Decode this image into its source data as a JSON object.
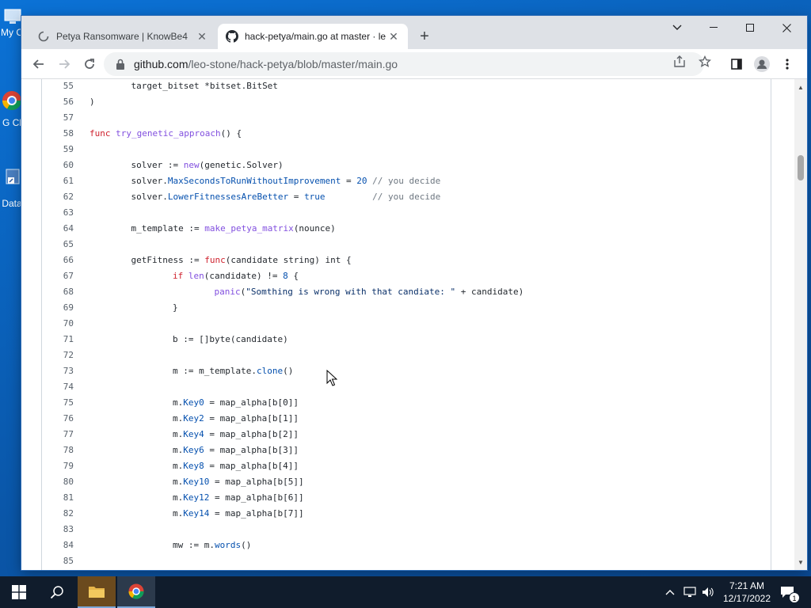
{
  "desktop": {
    "icons": [
      {
        "label": "My C"
      },
      {
        "label": "G Cl"
      },
      {
        "label": "Data"
      }
    ]
  },
  "browser": {
    "tabs": [
      {
        "title": "Petya Ransomware | KnowBe4",
        "active": false,
        "icon": "knowbe4-spinner-icon"
      },
      {
        "title": "hack-petya/main.go at master · le",
        "active": true,
        "icon": "github-icon"
      }
    ],
    "url_host": "github.com",
    "url_path": "/leo-stone/hack-petya/blob/master/main.go"
  },
  "code": {
    "lines": [
      {
        "n": "55",
        "indent": 1,
        "parts": [
          {
            "t": "target_bitset *bitset.BitSet"
          }
        ]
      },
      {
        "n": "56",
        "indent": 0,
        "parts": [
          {
            "t": ")"
          }
        ]
      },
      {
        "n": "57",
        "indent": 0,
        "parts": []
      },
      {
        "n": "58",
        "indent": 0,
        "parts": [
          {
            "t": "func",
            "c": "kw"
          },
          {
            "t": " "
          },
          {
            "t": "try_genetic_approach",
            "c": "fn"
          },
          {
            "t": "() {"
          }
        ]
      },
      {
        "n": "59",
        "indent": 0,
        "parts": []
      },
      {
        "n": "60",
        "indent": 1,
        "parts": [
          {
            "t": "solver := "
          },
          {
            "t": "new",
            "c": "fn"
          },
          {
            "t": "(genetic.Solver)"
          }
        ]
      },
      {
        "n": "61",
        "indent": 1,
        "parts": [
          {
            "t": "solver."
          },
          {
            "t": "MaxSecondsToRunWithoutImprovement",
            "c": "prop"
          },
          {
            "t": " = "
          },
          {
            "t": "20",
            "c": "num"
          },
          {
            "t": " "
          },
          {
            "t": "// you decide",
            "c": "cm"
          }
        ]
      },
      {
        "n": "62",
        "indent": 1,
        "parts": [
          {
            "t": "solver."
          },
          {
            "t": "LowerFitnessesAreBetter",
            "c": "prop"
          },
          {
            "t": " = "
          },
          {
            "t": "true",
            "c": "num"
          },
          {
            "t": "         "
          },
          {
            "t": "// you decide",
            "c": "cm"
          }
        ]
      },
      {
        "n": "63",
        "indent": 0,
        "parts": []
      },
      {
        "n": "64",
        "indent": 1,
        "parts": [
          {
            "t": "m_template := "
          },
          {
            "t": "make_petya_matrix",
            "c": "fn"
          },
          {
            "t": "(nounce)"
          }
        ]
      },
      {
        "n": "65",
        "indent": 0,
        "parts": []
      },
      {
        "n": "66",
        "indent": 1,
        "parts": [
          {
            "t": "getFitness := "
          },
          {
            "t": "func",
            "c": "kw"
          },
          {
            "t": "(candidate string) int {"
          }
        ]
      },
      {
        "n": "67",
        "indent": 2,
        "parts": [
          {
            "t": "if",
            "c": "kw"
          },
          {
            "t": " "
          },
          {
            "t": "len",
            "c": "fn"
          },
          {
            "t": "(candidate) != "
          },
          {
            "t": "8",
            "c": "num"
          },
          {
            "t": " {"
          }
        ]
      },
      {
        "n": "68",
        "indent": 3,
        "parts": [
          {
            "t": "panic",
            "c": "fn"
          },
          {
            "t": "("
          },
          {
            "t": "\"Somthing is wrong with that candiate: \"",
            "c": "str"
          },
          {
            "t": " + candidate)"
          }
        ]
      },
      {
        "n": "69",
        "indent": 2,
        "parts": [
          {
            "t": "}"
          }
        ]
      },
      {
        "n": "70",
        "indent": 0,
        "parts": []
      },
      {
        "n": "71",
        "indent": 2,
        "parts": [
          {
            "t": "b := []byte(candidate)"
          }
        ]
      },
      {
        "n": "72",
        "indent": 0,
        "parts": []
      },
      {
        "n": "73",
        "indent": 2,
        "parts": [
          {
            "t": "m := m_template."
          },
          {
            "t": "clone",
            "c": "prop"
          },
          {
            "t": "()"
          }
        ]
      },
      {
        "n": "74",
        "indent": 0,
        "parts": []
      },
      {
        "n": "75",
        "indent": 2,
        "parts": [
          {
            "t": "m."
          },
          {
            "t": "Key0",
            "c": "prop"
          },
          {
            "t": " = map_alpha[b[0]]"
          }
        ]
      },
      {
        "n": "76",
        "indent": 2,
        "parts": [
          {
            "t": "m."
          },
          {
            "t": "Key2",
            "c": "prop"
          },
          {
            "t": " = map_alpha[b[1]]"
          }
        ]
      },
      {
        "n": "77",
        "indent": 2,
        "parts": [
          {
            "t": "m."
          },
          {
            "t": "Key4",
            "c": "prop"
          },
          {
            "t": " = map_alpha[b[2]]"
          }
        ]
      },
      {
        "n": "78",
        "indent": 2,
        "parts": [
          {
            "t": "m."
          },
          {
            "t": "Key6",
            "c": "prop"
          },
          {
            "t": " = map_alpha[b[3]]"
          }
        ]
      },
      {
        "n": "79",
        "indent": 2,
        "parts": [
          {
            "t": "m."
          },
          {
            "t": "Key8",
            "c": "prop"
          },
          {
            "t": " = map_alpha[b[4]]"
          }
        ]
      },
      {
        "n": "80",
        "indent": 2,
        "parts": [
          {
            "t": "m."
          },
          {
            "t": "Key10",
            "c": "prop"
          },
          {
            "t": " = map_alpha[b[5]]"
          }
        ]
      },
      {
        "n": "81",
        "indent": 2,
        "parts": [
          {
            "t": "m."
          },
          {
            "t": "Key12",
            "c": "prop"
          },
          {
            "t": " = map_alpha[b[6]]"
          }
        ]
      },
      {
        "n": "82",
        "indent": 2,
        "parts": [
          {
            "t": "m."
          },
          {
            "t": "Key14",
            "c": "prop"
          },
          {
            "t": " = map_alpha[b[7]]"
          }
        ]
      },
      {
        "n": "83",
        "indent": 0,
        "parts": []
      },
      {
        "n": "84",
        "indent": 2,
        "parts": [
          {
            "t": "mw := m."
          },
          {
            "t": "words",
            "c": "prop"
          },
          {
            "t": "()"
          }
        ]
      },
      {
        "n": "85",
        "indent": 0,
        "parts": []
      }
    ]
  },
  "taskbar": {
    "time": "7:21 AM",
    "date": "12/17/2022",
    "notification_count": "1"
  },
  "colors": {
    "keyword": "#cf222e",
    "function": "#8250df",
    "property": "#0550ae",
    "string": "#0a3069",
    "comment": "#6e7781",
    "taskbar": "#101c2c",
    "desktop": "#0a56a8"
  }
}
